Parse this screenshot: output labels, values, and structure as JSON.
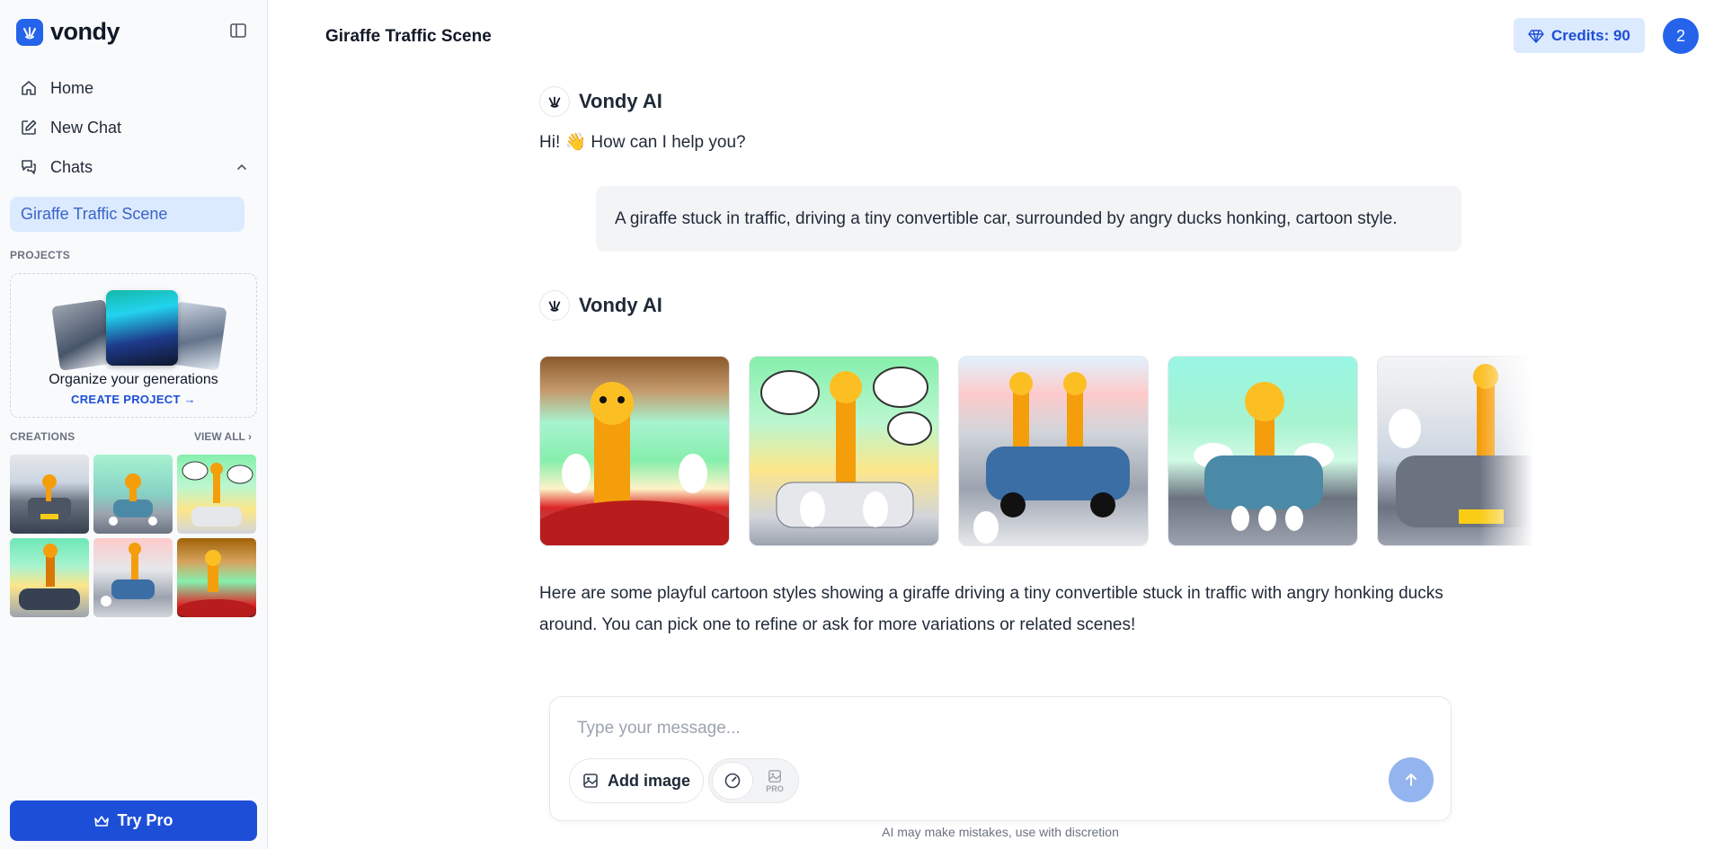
{
  "brand": {
    "name": "vondy"
  },
  "sidebar": {
    "nav": [
      {
        "label": "Home",
        "icon": "home-icon"
      },
      {
        "label": "New Chat",
        "icon": "edit-icon"
      },
      {
        "label": "Chats",
        "icon": "chats-icon"
      }
    ],
    "active_chat": "Giraffe Traffic Scene",
    "projects_label": "PROJECTS",
    "project_card": {
      "title": "Organize your generations",
      "link": "CREATE PROJECT"
    },
    "creations_label": "CREATIONS",
    "view_all": "VIEW ALL",
    "try_pro": "Try Pro"
  },
  "header": {
    "title": "Giraffe Traffic Scene",
    "credits": "Credits: 90",
    "avatar_initial": "2"
  },
  "chat": {
    "bot_name": "Vondy AI",
    "greeting": "Hi! 👋 How can I help you?",
    "user_prompt": "A giraffe stuck in traffic, driving a tiny convertible car, surrounded by angry ducks honking, cartoon style.",
    "reply": "Here are some playful cartoon styles showing a giraffe driving a tiny convertible stuck in traffic with angry honking ducks around. You can pick one to refine or ask for more variations or related scenes!"
  },
  "composer": {
    "placeholder": "Type your message...",
    "add_image": "Add image",
    "pro_tag": "PRO",
    "disclaimer": "AI may make mistakes, use with discretion"
  },
  "colors": {
    "accent": "#1d4ed8",
    "active_bg": "#dbeafe",
    "send": "#93b4ee"
  }
}
